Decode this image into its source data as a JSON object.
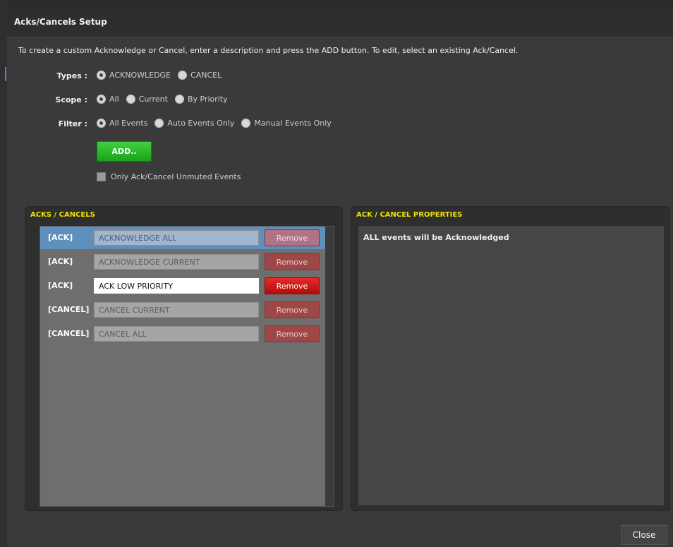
{
  "window": {
    "title": "Acks/Cancels Setup"
  },
  "instructions": "To create a custom Acknowledge or Cancel, enter a description and press the ADD button. To edit, select an existing Ack/Cancel.",
  "types": {
    "label": "Types :",
    "options": [
      {
        "label": "ACKNOWLEDGE",
        "selected": true
      },
      {
        "label": "CANCEL",
        "selected": false
      }
    ]
  },
  "scope": {
    "label": "Scope :",
    "options": [
      {
        "label": "All",
        "selected": true
      },
      {
        "label": "Current",
        "selected": false
      },
      {
        "label": "By Priority",
        "selected": false
      }
    ]
  },
  "filter": {
    "label": "Filter :",
    "options": [
      {
        "label": "All Events",
        "selected": true
      },
      {
        "label": "Auto Events Only",
        "selected": false
      },
      {
        "label": "Manual Events Only",
        "selected": false
      }
    ]
  },
  "add_button": "ADD..",
  "unmuted_checkbox": {
    "label": "Only Ack/Cancel Unmuted Events",
    "checked": false
  },
  "acks_panel": {
    "title": "ACKS / CANCELS",
    "rows": [
      {
        "type": "[ACK]",
        "description": "ACKNOWLEDGE ALL",
        "remove": "Remove",
        "state": "selected"
      },
      {
        "type": "[ACK]",
        "description": "ACKNOWLEDGE CURRENT",
        "remove": "Remove",
        "state": "normal"
      },
      {
        "type": "[ACK]",
        "description": "ACK LOW PRIORITY",
        "remove": "Remove",
        "state": "active"
      },
      {
        "type": "[CANCEL]",
        "description": "CANCEL CURRENT",
        "remove": "Remove",
        "state": "normal"
      },
      {
        "type": "[CANCEL]",
        "description": "CANCEL ALL",
        "remove": "Remove",
        "state": "normal"
      }
    ]
  },
  "props_panel": {
    "title": "ACK / CANCEL PROPERTIES",
    "text": "ALL events will be Acknowledged"
  },
  "close_button": "Close",
  "colors": {
    "accent_yellow": "#f2e300",
    "add_green": "#22b622",
    "remove_red": "#d21a1a",
    "selection_blue": "#5f8fbd"
  }
}
